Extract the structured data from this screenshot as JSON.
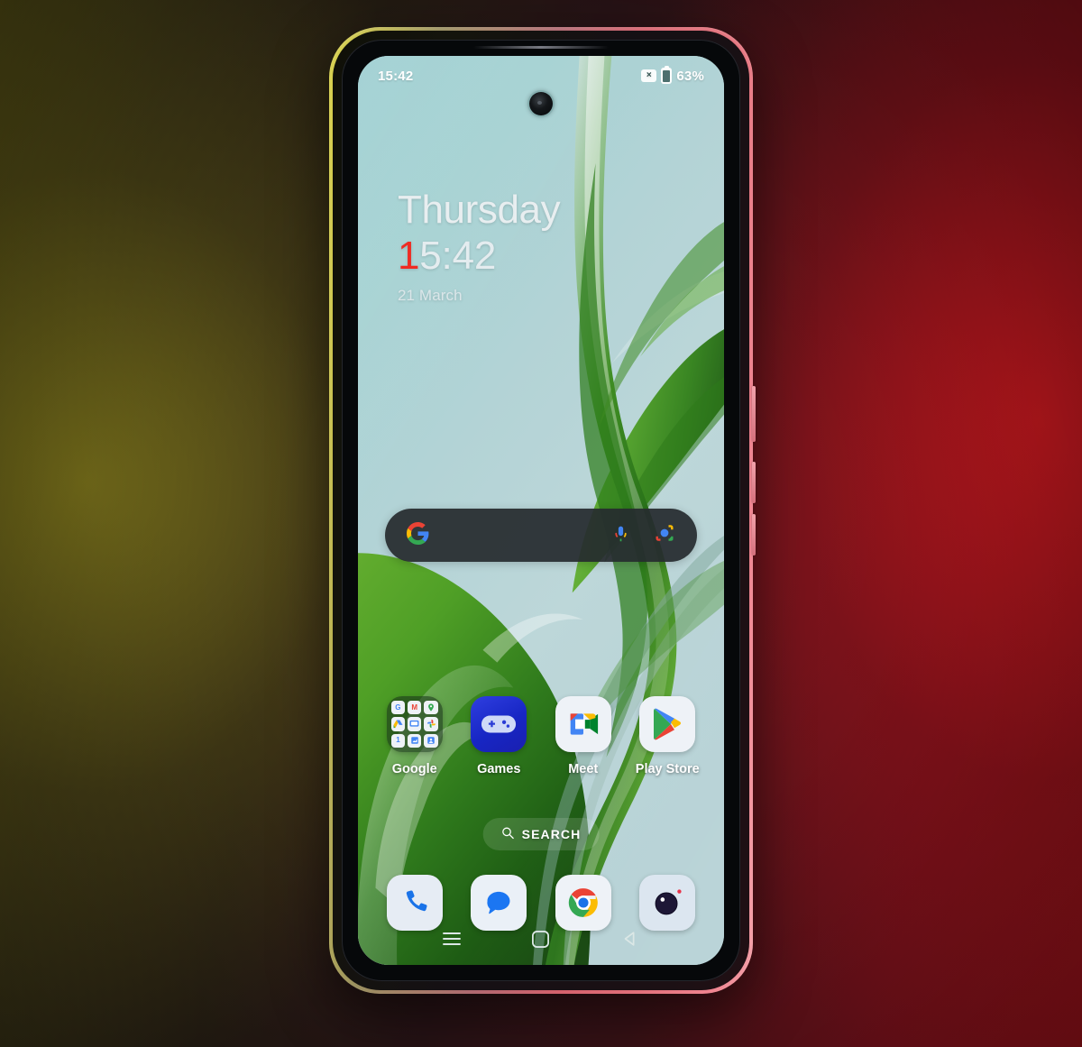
{
  "device": {
    "name": "smartphone",
    "frame_gradient_left": "#d8d14a",
    "frame_gradient_right": "#f4a0a8"
  },
  "backdrop": {
    "left_color": "#5d5718",
    "right_color": "#b4161f"
  },
  "status_bar": {
    "time": "15:42",
    "sim_badge": "×",
    "sim_badge_name": "no-sim-icon",
    "battery_percent": "63%",
    "battery_icon": "battery-icon"
  },
  "clock_widget": {
    "day": "Thursday",
    "time_accent": "1",
    "time_rest": "5:42",
    "date": "21 March"
  },
  "search_bar": {
    "logo": "google-g-logo",
    "placeholder": "",
    "mic_icon": "microphone-icon",
    "lens_icon": "google-lens-icon"
  },
  "app_grid": [
    {
      "label": "Google",
      "icon": "google-folder-icon",
      "type": "folder",
      "mini_icons": [
        "G",
        "M",
        "map",
        "drive",
        "chat",
        "photos",
        "1",
        "sheets",
        "contacts"
      ]
    },
    {
      "label": "Games",
      "icon": "gamepad-icon",
      "type": "app"
    },
    {
      "label": "Meet",
      "icon": "meet-camera-icon",
      "type": "app"
    },
    {
      "label": "Play Store",
      "icon": "play-store-icon",
      "type": "app"
    }
  ],
  "search_pill": {
    "label": "SEARCH",
    "icon": "magnifier-icon"
  },
  "dock": [
    {
      "label": "Phone",
      "icon": "phone-handset-icon"
    },
    {
      "label": "Messages",
      "icon": "message-bubble-icon"
    },
    {
      "label": "Chrome",
      "icon": "chrome-icon"
    },
    {
      "label": "Camera",
      "icon": "camera-lens-icon"
    }
  ],
  "nav_bar": [
    {
      "label": "Recents",
      "icon": "hamburger-recents-icon"
    },
    {
      "label": "Home",
      "icon": "square-home-icon"
    },
    {
      "label": "Back",
      "icon": "back-triangle-icon"
    }
  ],
  "wallpaper": {
    "description": "abstract green glossy ribbon on light blue-teal",
    "base_color": "#a9ced2",
    "ribbon_color": "#4ea72e"
  }
}
